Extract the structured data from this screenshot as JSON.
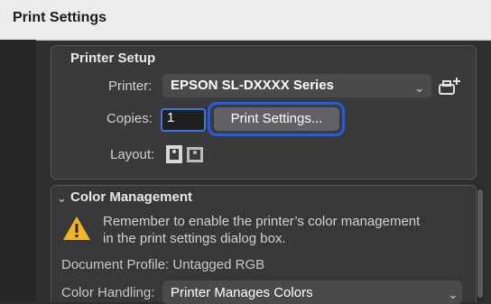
{
  "window": {
    "title": "Print Settings"
  },
  "printer_setup": {
    "header": "Printer Setup",
    "printer_label": "Printer:",
    "printer_value": "EPSON SL-DXXXX Series",
    "copies_label": "Copies:",
    "copies_value": "1",
    "print_settings_button": "Print Settings...",
    "layout_label": "Layout:"
  },
  "color_management": {
    "header": "Color Management",
    "warning_text": "Remember to enable the printer’s color management in the print settings dialog box.",
    "document_profile": "Document Profile: Untagged RGB",
    "color_handling_label": "Color Handling:",
    "color_handling_value": "Printer Manages Colors"
  },
  "colors": {
    "highlight": "#1c5fe6",
    "warning": "#f0b429"
  }
}
